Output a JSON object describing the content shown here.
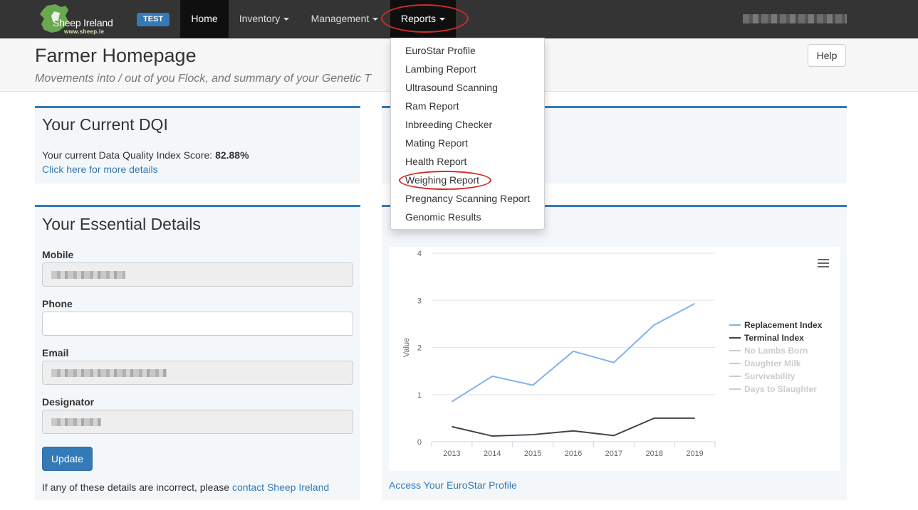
{
  "navbar": {
    "logo_text": "Sheep Ireland",
    "logo_subtext": "www.sheep.ie",
    "env_badge": "TEST",
    "items": [
      {
        "label": "Home"
      },
      {
        "label": "Inventory"
      },
      {
        "label": "Management"
      },
      {
        "label": "Reports"
      }
    ]
  },
  "reports_menu": [
    "EuroStar Profile",
    "Lambing Report",
    "Ultrasound Scanning",
    "Ram Report",
    "Inbreeding Checker",
    "Mating Report",
    "Health Report",
    "Weighing Report",
    "Pregnancy Scanning Report",
    "Genomic Results"
  ],
  "header": {
    "title": "Farmer Homepage",
    "subtitle": "Movements into / out of you Flock, and summary of your Genetic T",
    "help_label": "Help"
  },
  "dqi": {
    "title": "Your Current DQI",
    "text_prefix": "Your current Data Quality Index Score: ",
    "score": "82.88%",
    "link": "Click here for more details"
  },
  "essential": {
    "title": "Your Essential Details",
    "fields": [
      {
        "label": "Mobile"
      },
      {
        "label": "Phone"
      },
      {
        "label": "Email"
      },
      {
        "label": "Designator"
      }
    ],
    "update_label": "Update",
    "footnote_prefix": "If any of these details are incorrect, please ",
    "footnote_link": "contact Sheep Ireland"
  },
  "chart_link": "Access Your EuroStar Profile",
  "chart_data": {
    "type": "line",
    "x": [
      "2013",
      "2014",
      "2015",
      "2016",
      "2017",
      "2018",
      "2019"
    ],
    "ylabel": "Value",
    "xlabel": "",
    "ylim": [
      0,
      4
    ],
    "yticks": [
      0,
      1,
      2,
      3,
      4
    ],
    "grid": true,
    "legend_position": "right",
    "series": [
      {
        "name": "Replacement Index",
        "color": "#7cb5ec",
        "visible": true,
        "values": [
          0.85,
          1.39,
          1.2,
          1.92,
          1.68,
          2.48,
          2.93
        ]
      },
      {
        "name": "Terminal Index",
        "color": "#434348",
        "visible": true,
        "values": [
          0.32,
          0.12,
          0.15,
          0.23,
          0.13,
          0.5,
          0.5
        ]
      },
      {
        "name": "No Lambs Born",
        "color": "#cccccc",
        "visible": false
      },
      {
        "name": "Daughter Milk",
        "color": "#cccccc",
        "visible": false
      },
      {
        "name": "Survivability",
        "color": "#cccccc",
        "visible": false
      },
      {
        "name": "Days to Slaughter",
        "color": "#cccccc",
        "visible": false
      }
    ]
  }
}
